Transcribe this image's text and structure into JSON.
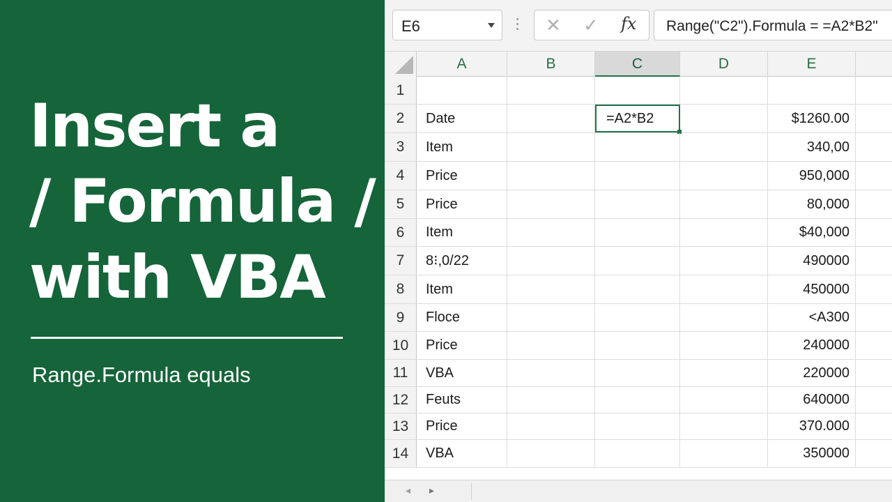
{
  "hero": {
    "title_lines": [
      "Insert a",
      "/ Formula /",
      "with VBA"
    ],
    "subtitle": "Range.Formula equals",
    "panel_color": "#15643a"
  },
  "formula_bar": {
    "name_box": "E6",
    "cancel_icon": "✕",
    "enter_icon": "✓",
    "fx_label": "fx",
    "formula": "Range(\"C2\").Formula = =A2*B2\""
  },
  "grid": {
    "accent_color": "#217346",
    "columns": [
      "A",
      "B",
      "C",
      "D",
      "E"
    ],
    "selected_column": "C",
    "active_cell": "C2",
    "rows": [
      {
        "n": "1",
        "a": "",
        "c": "",
        "e": ""
      },
      {
        "n": "2",
        "a": "Date",
        "c": "=A2*B2",
        "e": "$1260.00"
      },
      {
        "n": "3",
        "a": "Item",
        "c": "",
        "e": "340,00"
      },
      {
        "n": "4",
        "a": "Price",
        "c": "",
        "e": "950,000"
      },
      {
        "n": "5",
        "a": "Price",
        "c": "",
        "e": "80,000"
      },
      {
        "n": "6",
        "a": "Item",
        "c": "",
        "e": "$40,000"
      },
      {
        "n": "7",
        "a": "8⁝,0/22",
        "c": "",
        "e": "490000"
      },
      {
        "n": "8",
        "a": "Item",
        "c": "",
        "e": "450000"
      },
      {
        "n": "9",
        "a": "Floce",
        "c": "",
        "e": "<A300"
      },
      {
        "n": "10",
        "a": "Price",
        "c": "",
        "e": "240000"
      },
      {
        "n": "11",
        "a": "VBA",
        "c": "",
        "e": "220000"
      },
      {
        "n": "12",
        "a": "Feuts",
        "c": "",
        "e": "640000"
      },
      {
        "n": "13",
        "a": "Price",
        "c": "",
        "e": "370.000"
      },
      {
        "n": "14",
        "a": "VBA",
        "c": "",
        "e": "350000"
      }
    ]
  },
  "sheet_nav": {
    "prev_icon": "◂",
    "next_icon": "▸"
  }
}
